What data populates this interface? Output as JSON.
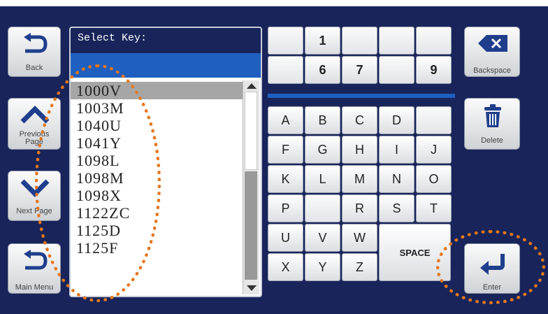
{
  "side_buttons": {
    "back": "Back",
    "previous_page": "Previous\nPage",
    "next_page": "Next Page",
    "main_menu": "Main Menu"
  },
  "key_list": {
    "title": "Select Key:",
    "items": [
      "1000V",
      "1003M",
      "1040U",
      "1041Y",
      "1098L",
      "1098M",
      "1098X",
      "1122ZC",
      "1125D",
      "1125F"
    ],
    "selected_index": 0
  },
  "keypad": {
    "digit_rows": [
      [
        "",
        "1",
        "",
        "",
        ""
      ],
      [
        "",
        "6",
        "7",
        "",
        "9"
      ]
    ],
    "letter_rows": [
      [
        "A",
        "B",
        "C",
        "D",
        ""
      ],
      [
        "F",
        "G",
        "H",
        "I",
        "J"
      ],
      [
        "K",
        "L",
        "M",
        "N",
        "O"
      ],
      [
        "P",
        "",
        "R",
        "S",
        "T"
      ],
      [
        "U",
        "V",
        "W"
      ],
      [
        "X",
        "Y",
        "Z"
      ]
    ],
    "space_label": "SPACE"
  },
  "right_buttons": {
    "backspace": "Backspace",
    "delete": "Delete",
    "enter": "Enter"
  },
  "colors": {
    "background": "#18245a",
    "accent_bar": "#1f5fc0",
    "selected_row": "#a6a6a6",
    "highlight": "#e5771b"
  }
}
